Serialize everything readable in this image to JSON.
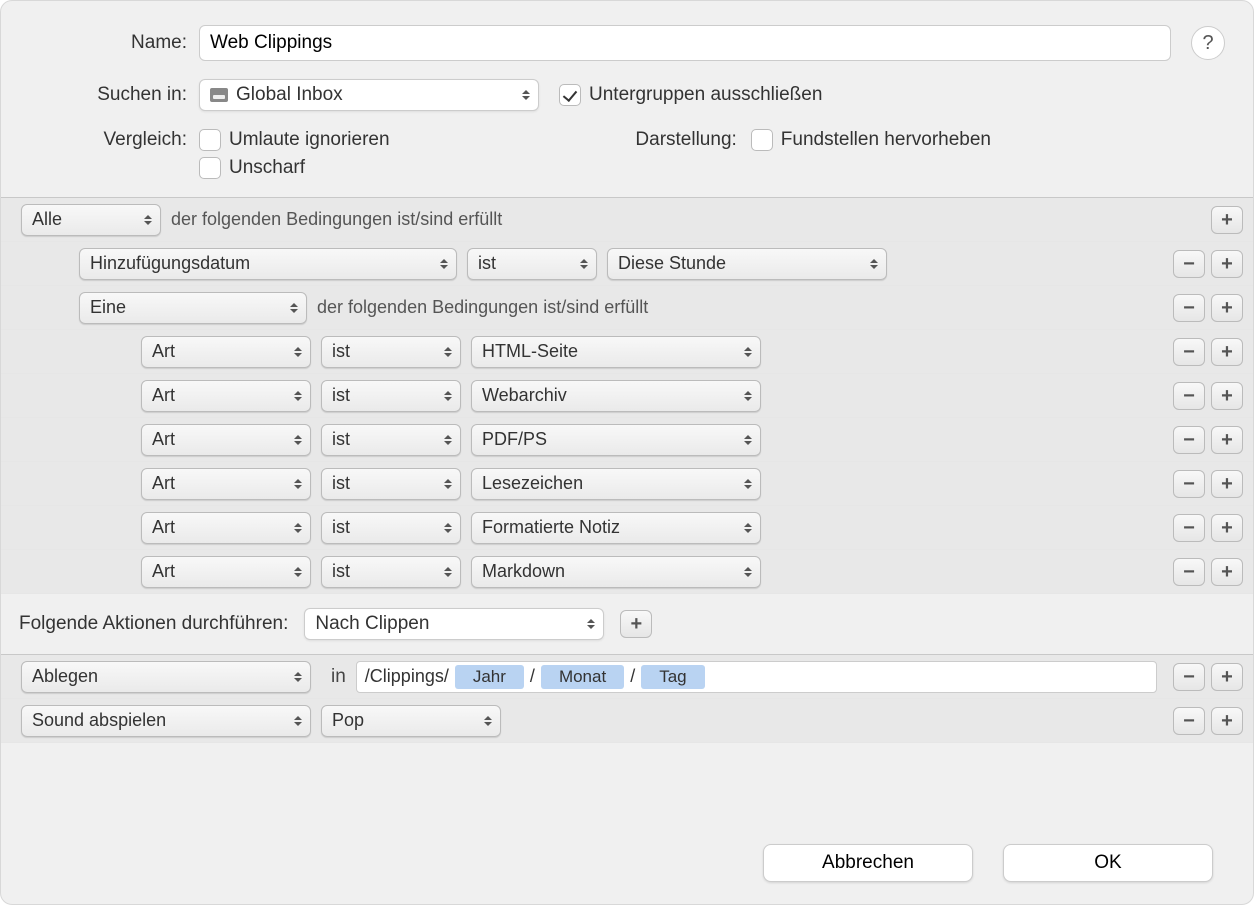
{
  "labels": {
    "name": "Name:",
    "search_in": "Suchen in:",
    "compare": "Vergleich:",
    "display": "Darstellung:",
    "actions_header": "Folgende Aktionen durchführen:",
    "in": "in",
    "cond_text": "der folgenden Bedingungen ist/sind erfüllt"
  },
  "name_value": "Web Clippings",
  "search_in_value": "Global Inbox",
  "exclude_subgroups": {
    "label": "Untergruppen ausschließen",
    "checked": true
  },
  "ignore_umlauts": {
    "label": "Umlaute ignorieren",
    "checked": false
  },
  "fuzzy": {
    "label": "Unscharf",
    "checked": false
  },
  "highlight_matches": {
    "label": "Fundstellen hervorheben",
    "checked": false
  },
  "match_scope": "Alle",
  "conditions": {
    "c1": {
      "field": "Hinzufügungsdatum",
      "op": "ist",
      "value": "Diese Stunde"
    },
    "sub_scope": "Eine",
    "sub": [
      {
        "field": "Art",
        "op": "ist",
        "value": "HTML-Seite"
      },
      {
        "field": "Art",
        "op": "ist",
        "value": "Webarchiv"
      },
      {
        "field": "Art",
        "op": "ist",
        "value": "PDF/PS"
      },
      {
        "field": "Art",
        "op": "ist",
        "value": "Lesezeichen"
      },
      {
        "field": "Art",
        "op": "ist",
        "value": "Formatierte Notiz"
      },
      {
        "field": "Art",
        "op": "ist",
        "value": "Markdown"
      }
    ]
  },
  "action_dropdown": "Nach Clippen",
  "actions": {
    "a1": {
      "type": "Ablegen",
      "path_prefix": "/Clippings/",
      "tokens": [
        "Jahr",
        "Monat",
        "Tag"
      ],
      "sep": "/"
    },
    "a2": {
      "type": "Sound abspielen",
      "value": "Pop"
    }
  },
  "buttons": {
    "cancel": "Abbrechen",
    "ok": "OK"
  }
}
